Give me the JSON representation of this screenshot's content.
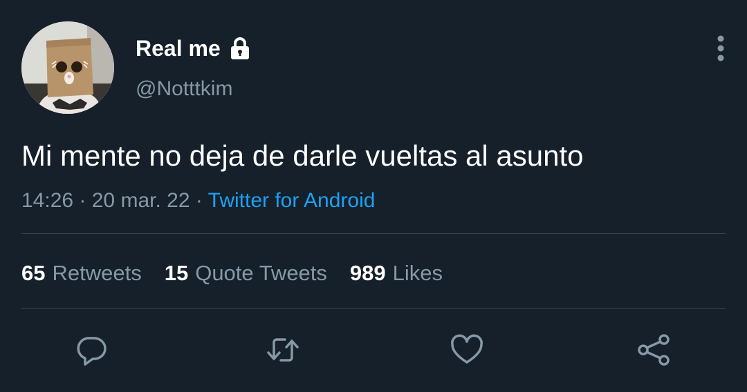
{
  "user": {
    "display_name": "Real me",
    "handle": "@Notttkim",
    "protected_icon": "lock-icon",
    "avatar": "paper-bag-cat-avatar"
  },
  "tweet": {
    "text": "Mi mente no deja de darle vueltas al asunto",
    "time": "14:26",
    "separator": "·",
    "date": "20 mar. 22",
    "source": "Twitter for Android"
  },
  "stats": {
    "retweets_count": "65",
    "retweets_label": "Retweets",
    "quotes_count": "15",
    "quotes_label": "Quote Tweets",
    "likes_count": "989",
    "likes_label": "Likes"
  },
  "actions": [
    "reply-icon",
    "retweet-icon",
    "like-icon",
    "share-icon"
  ],
  "colors": {
    "background": "#15202b",
    "primary_text": "#ffffff",
    "secondary_text": "#8899a6",
    "link": "#1da1f2",
    "divider": "#38444d"
  }
}
